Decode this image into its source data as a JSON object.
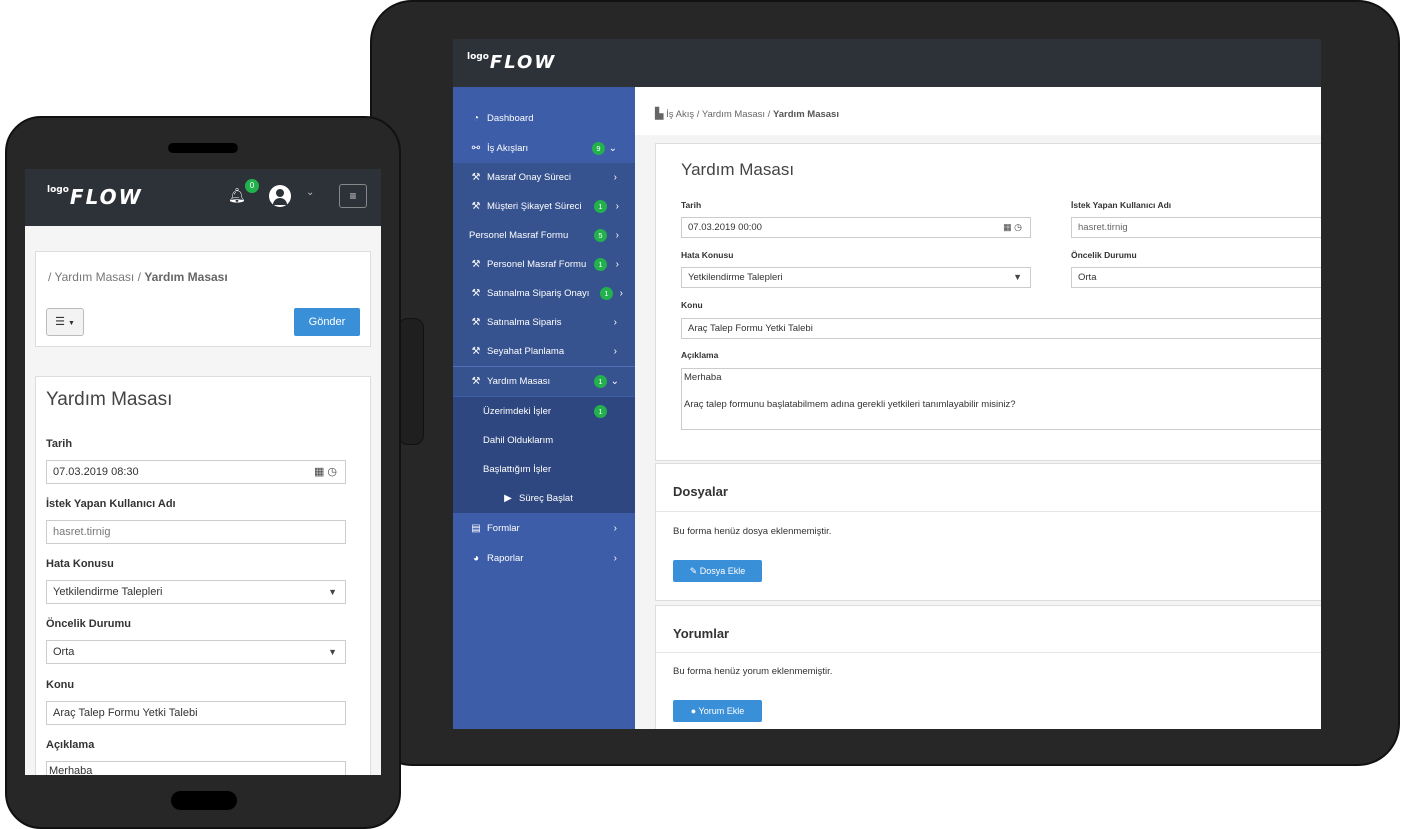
{
  "brand": {
    "logo_small": "logo",
    "logo_main": "FLOW"
  },
  "tablet": {
    "sidebar": {
      "items": [
        {
          "label": "Dashboard",
          "icon": "gauge-icon"
        },
        {
          "label": "İş Akışları",
          "icon": "sitemap-icon",
          "badge": "9",
          "arrow": "⌄"
        },
        {
          "label": "Masraf Onay Süreci",
          "icon": "tools-icon",
          "arrow": "›"
        },
        {
          "label": "Müşteri Şikayet Süreci",
          "icon": "tools-icon",
          "badge": "1",
          "arrow": "›"
        },
        {
          "label": "Personel Masraf Formu",
          "badge": "5",
          "arrow": "›"
        },
        {
          "label": "Personel Masraf Formu",
          "icon": "tools-icon",
          "badge": "1",
          "arrow": "›"
        },
        {
          "label": "Satınalma Sipariş Onayı",
          "icon": "tools-icon",
          "badge": "1",
          "arrow": "›"
        },
        {
          "label": "Satınalma Siparis",
          "icon": "tools-icon",
          "arrow": "›"
        },
        {
          "label": "Seyahat Planlama",
          "icon": "tools-icon",
          "arrow": "›"
        },
        {
          "label": "Yardım Masası",
          "icon": "tools-icon",
          "badge": "1",
          "arrow": "⌄"
        },
        {
          "label": "Üzerimdeki İşler",
          "badge": "1"
        },
        {
          "label": "Dahil Olduklarım"
        },
        {
          "label": "Başlattığım İşler"
        },
        {
          "label": "Süreç Başlat",
          "icon": "play-icon"
        },
        {
          "label": "Formlar",
          "icon": "form-icon",
          "arrow": "›"
        },
        {
          "label": "Raporlar",
          "icon": "pie-chart-icon",
          "arrow": "›"
        }
      ]
    },
    "breadcrumb": {
      "part1": "İş Akış",
      "sep": "/",
      "part2": "Yardım Masası",
      "current": "Yardım Masası"
    },
    "form": {
      "title": "Yardım Masası",
      "date_label": "Tarih",
      "date_value": "07.03.2019 00:00",
      "user_label": "İstek Yapan Kullanıcı Adı",
      "user_value": "hasret.tirnig",
      "topic_label": "Hata Konusu",
      "topic_value": "Yetkilendirme Talepleri",
      "priority_label": "Öncelik Durumu",
      "priority_value": "Orta",
      "subject_label": "Konu",
      "subject_value": "Araç Talep Formu Yetki Talebi",
      "desc_label": "Açıklama",
      "desc_line1": "Merhaba",
      "desc_line2": "Araç talep formunu başlatabilmem adına gerekli yetkileri tanımlayabilir misiniz?"
    },
    "files": {
      "title": "Dosyalar",
      "empty": "Bu forma henüz dosya eklenmemiştir.",
      "button": "Dosya Ekle"
    },
    "comments": {
      "title": "Yorumlar",
      "empty": "Bu forma henüz yorum eklenmemiştir.",
      "button": "Yorum Ekle"
    }
  },
  "phone": {
    "notification_count": "0",
    "breadcrumb": {
      "sep": "/",
      "part2": "Yardım Masası",
      "current": "Yardım Masası"
    },
    "send_button": "Gönder",
    "form": {
      "title": "Yardım Masası",
      "date_label": "Tarih",
      "date_value": "07.03.2019 08:30",
      "user_label": "İstek Yapan Kullanıcı Adı",
      "user_value": "hasret.tirnig",
      "topic_label": "Hata Konusu",
      "topic_value": "Yetkilendirme Talepleri",
      "priority_label": "Öncelik Durumu",
      "priority_value": "Orta",
      "subject_label": "Konu",
      "subject_value": "Araç Talep Formu Yetki Talebi",
      "desc_label": "Açıklama",
      "desc_line1": "Merhaba"
    }
  }
}
